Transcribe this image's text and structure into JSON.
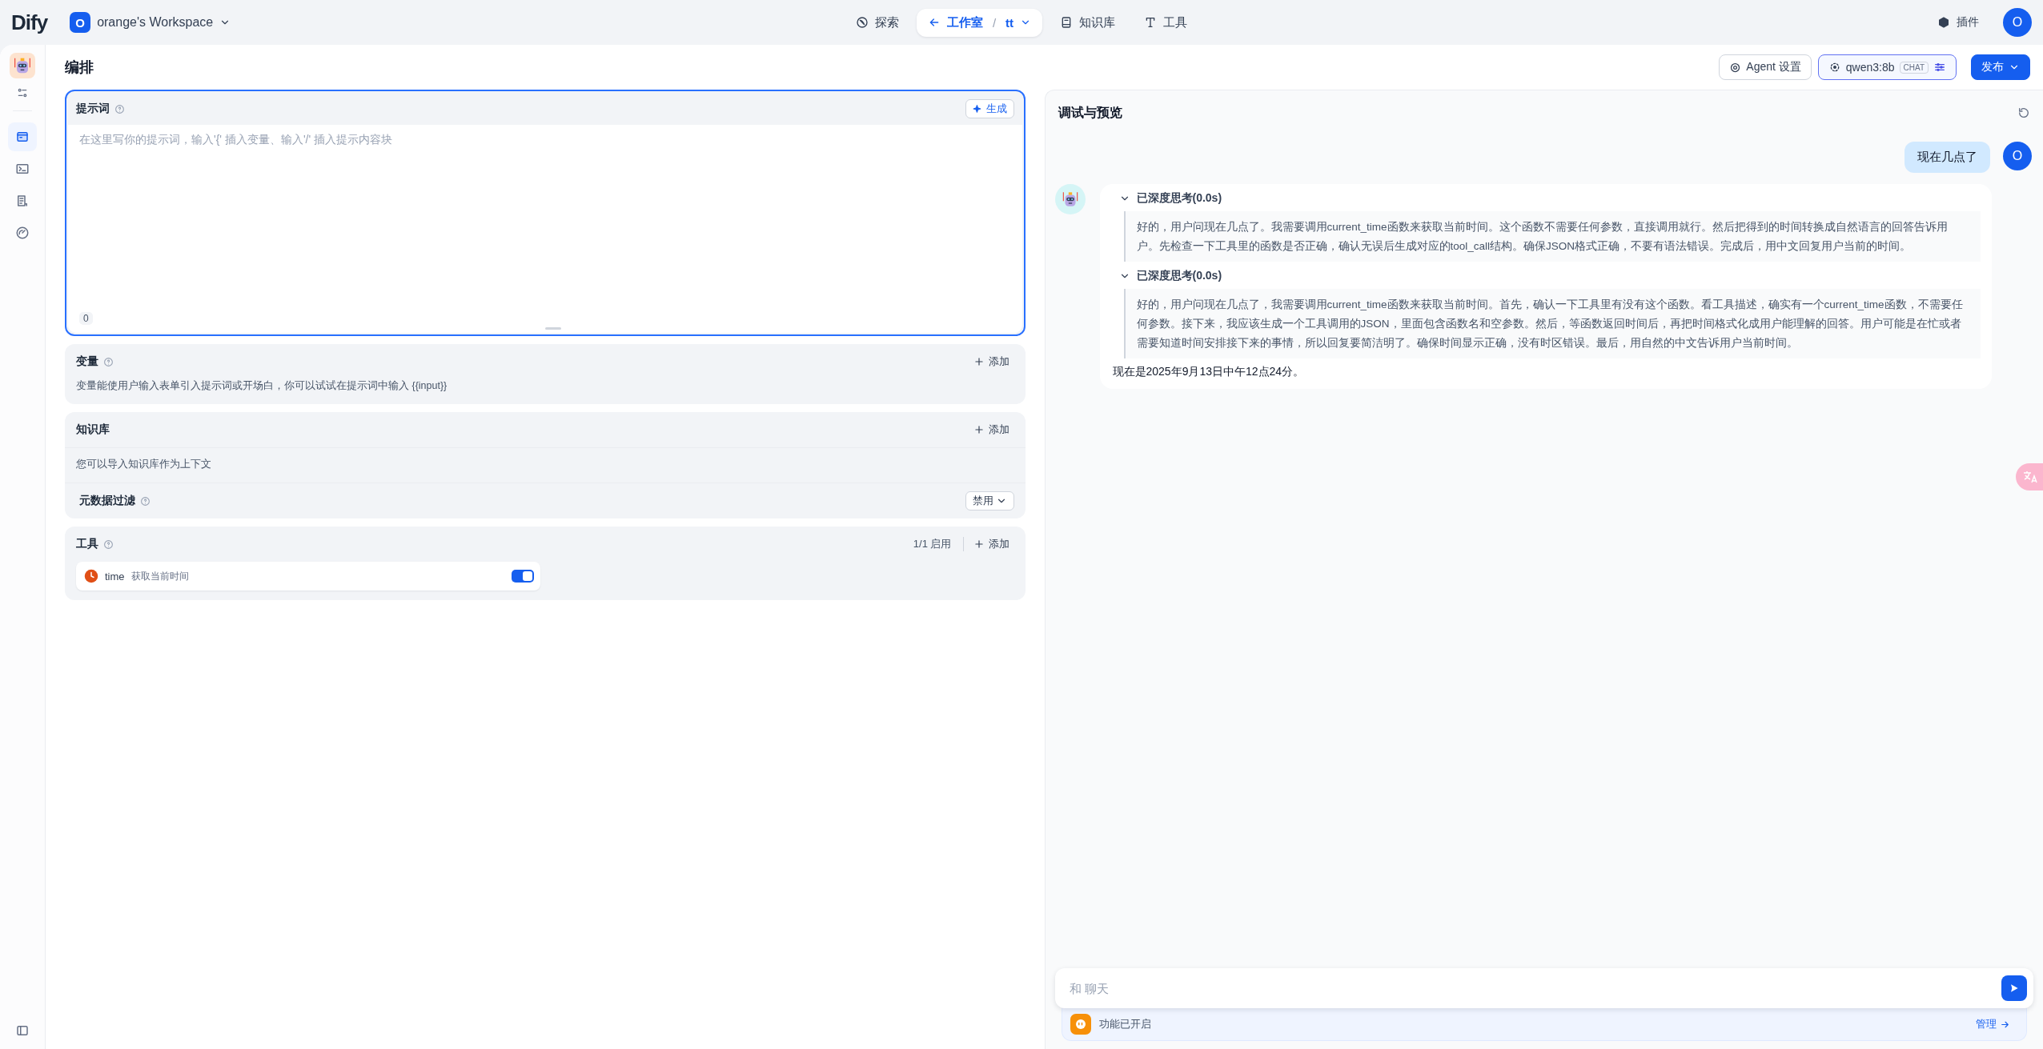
{
  "top_bar": {
    "logo": "Dify",
    "workspace": {
      "initial": "O",
      "name": "orange's Workspace"
    },
    "nav": [
      {
        "kind": "explore",
        "label": "探索",
        "selected": false
      },
      {
        "kind": "studio",
        "label": "工作室",
        "selected": true,
        "separator": "/",
        "app": "tt"
      },
      {
        "kind": "knowledge",
        "label": "知识库",
        "selected": false
      },
      {
        "kind": "tools",
        "label": "工具",
        "selected": false
      }
    ],
    "plugins": "插件",
    "avatar": "O"
  },
  "sidebar": {
    "items": [
      {
        "kind": "orchestrate",
        "selected": true
      },
      {
        "kind": "api",
        "selected": false
      },
      {
        "kind": "logs",
        "selected": false
      },
      {
        "kind": "monitor",
        "selected": false
      }
    ]
  },
  "page_title": "编排",
  "toolbar": {
    "agent_settings": "Agent 设置",
    "model": {
      "name": "qwen3:8b",
      "mode": "CHAT"
    },
    "publish": "发布"
  },
  "prompt": {
    "title": "提示词",
    "generate": "生成",
    "placeholder": "在这里写你的提示词，输入'{' 插入变量、输入'/' 插入提示内容块",
    "count": "0"
  },
  "variables": {
    "title": "变量",
    "add": "添加",
    "description": "变量能使用户输入表单引入提示词或开场白，你可以试试在提示词中输入 {{input}}"
  },
  "knowledge": {
    "title": "知识库",
    "add": "添加",
    "description": "您可以导入知识库作为上下文",
    "metadata_filter": {
      "label": "元数据过滤",
      "value": "禁用"
    }
  },
  "tools": {
    "title": "工具",
    "enabled_count": "1/1 启用",
    "add": "添加",
    "items": [
      {
        "name": "time",
        "description": "获取当前时间",
        "on": true
      }
    ]
  },
  "debug": {
    "title": "调试与预览",
    "messages": [
      {
        "kind": "user",
        "text": "现在几点了",
        "avatar": "O"
      },
      {
        "kind": "assistant",
        "thoughts": [
          {
            "title": "已深度思考(0.0s)",
            "expanded": true,
            "text": "好的，用户问现在几点了。我需要调用current_time函数来获取当前时间。这个函数不需要任何参数，直接调用就行。然后把得到的时间转换成自然语言的回答告诉用户。先检查一下工具里的函数是否正确，确认无误后生成对应的tool_call结构。确保JSON格式正确，不要有语法错误。完成后，用中文回复用户当前的时间。"
          },
          {
            "title": "已深度思考(0.0s)",
            "expanded": true,
            "text": "好的，用户问现在几点了，我需要调用current_time函数来获取当前时间。首先，确认一下工具里有没有这个函数。看工具描述，确实有一个current_time函数，不需要任何参数。接下来，我应该生成一个工具调用的JSON，里面包含函数名和空参数。然后，等函数返回时间后，再把时间格式化成用户能理解的回答。用户可能是在忙或者需要知道时间安排接下来的事情，所以回复要简洁明了。确保时间显示正确，没有时区错误。最后，用自然的中文告诉用户当前时间。"
          }
        ],
        "answer": "现在是2025年9月13日中午12点24分。"
      }
    ],
    "input": {
      "placeholder": "和 聊天"
    },
    "features": {
      "label": "功能已开启",
      "manage": "管理"
    }
  }
}
